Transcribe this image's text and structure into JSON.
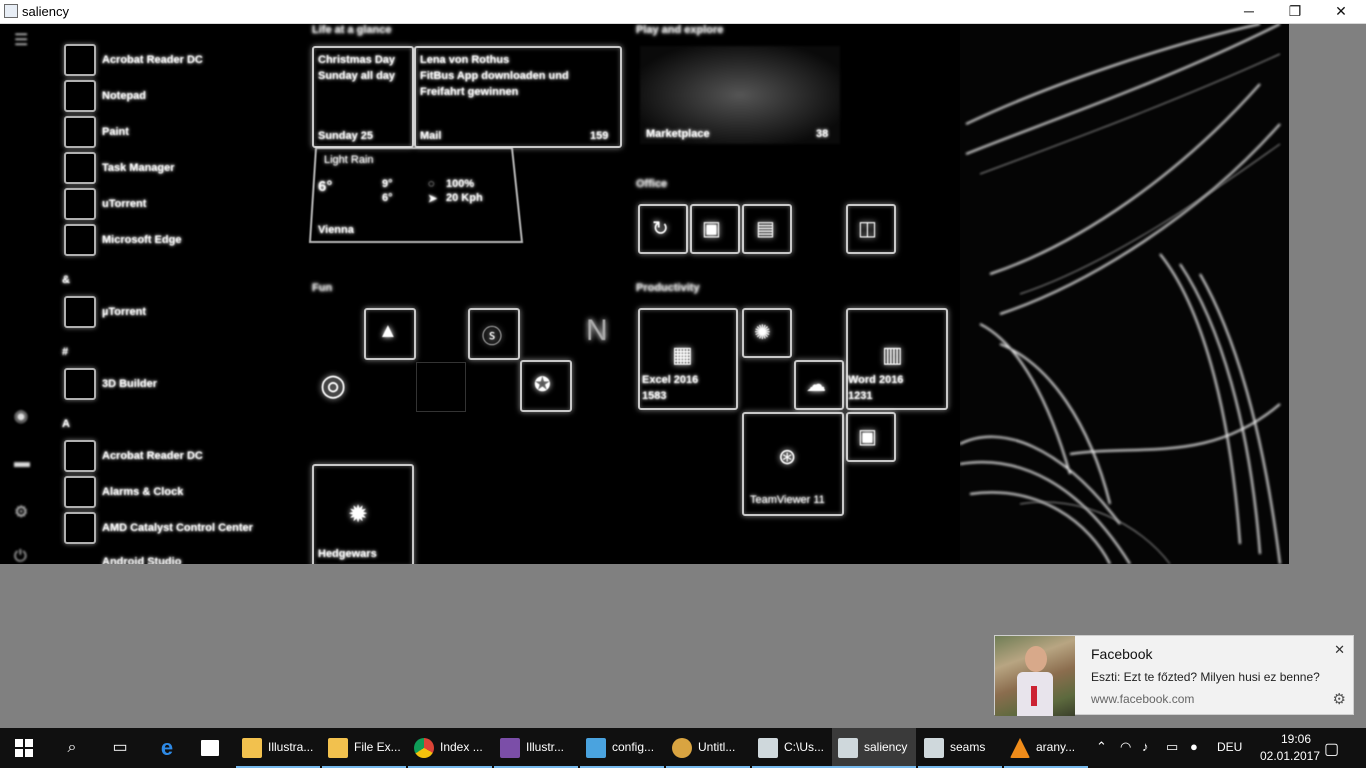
{
  "window": {
    "title": "saliency",
    "minimize_glyph": "─",
    "maximize_glyph": "❐",
    "close_glyph": "✕"
  },
  "canvas": {
    "left_apps": [
      {
        "label": "Acrobat Reader DC",
        "icon": "pdf-icon"
      },
      {
        "label": "Notepad",
        "icon": "notepad-icon"
      },
      {
        "label": "Paint",
        "icon": "paint-icon"
      },
      {
        "label": "Task Manager",
        "icon": "taskmanager-icon"
      },
      {
        "label": "uTorrent",
        "icon": "utorrent-icon"
      },
      {
        "label": "Microsoft Edge",
        "icon": "edge-icon"
      },
      {
        "label": "µTorrent",
        "icon": "utorrent-icon"
      },
      {
        "label": "3D Builder",
        "icon": "builder-icon"
      },
      {
        "label": "Acrobat Reader DC",
        "icon": "pdf-icon"
      },
      {
        "label": "Alarms & Clock",
        "icon": "alarm-icon"
      },
      {
        "label": "AMD Catalyst Control Center",
        "icon": "amd-icon"
      },
      {
        "label": "Android Studio",
        "icon": "android-icon"
      }
    ],
    "letters": [
      "&",
      "#",
      "A"
    ],
    "sections": {
      "life": "Life at a glance",
      "play": "Play and explore",
      "fun": "Fun",
      "office": "Office",
      "productivity": "Productivity"
    },
    "calendar": {
      "line1": "Christmas Day",
      "line2": "Sunday all day",
      "footer": "Sunday 25"
    },
    "mail": {
      "line1": "Lena von Rothus",
      "line2": "FitBus App downloaden und",
      "line3": "Freifahrt gewinnen",
      "footer": "Mail",
      "count": "159"
    },
    "weather": {
      "title": "Light Rain",
      "temp": "6°",
      "hi": "9°",
      "lo": "6°",
      "humidity": "100%",
      "wind": "20 Kph",
      "city": "Vienna"
    },
    "news": {
      "label": "Marketplace",
      "count": "38"
    },
    "tiles": {
      "excel_label": "Excel 2016",
      "excel_count": "1583",
      "word_label": "Word 2016",
      "word_count": "1231",
      "teamviewer": "TeamViewer 11",
      "hedgewars": "Hedgewars"
    }
  },
  "toast": {
    "app": "Facebook",
    "message": "Eszti: Ezt te főzted? Milyen husi ez benne?",
    "url": "www.facebook.com",
    "close_glyph": "✕",
    "gear_glyph": "⚙"
  },
  "taskbar": {
    "apps": [
      {
        "label": "Illustra...",
        "color": "#f2c14e",
        "active": false
      },
      {
        "label": "File Ex...",
        "color": "#f2c14e",
        "active": false
      },
      {
        "label": "Index ...",
        "color": "#4caf50",
        "active": false
      },
      {
        "label": "Illustr...",
        "color": "#7b4ea8",
        "active": false
      },
      {
        "label": "config...",
        "color": "#4aa3df",
        "active": false
      },
      {
        "label": "Untitl...",
        "color": "#d9a441",
        "active": false
      },
      {
        "label": "C:\\Us...",
        "color": "#cfd8dc",
        "active": false
      },
      {
        "label": "saliency",
        "color": "#cfd8dc",
        "active": true
      },
      {
        "label": "seams",
        "color": "#cfd8dc",
        "active": false
      },
      {
        "label": "arany...",
        "color": "#f08c1a",
        "active": false
      }
    ],
    "language": "DEU",
    "time": "19:06",
    "date": "02.01.2017"
  }
}
